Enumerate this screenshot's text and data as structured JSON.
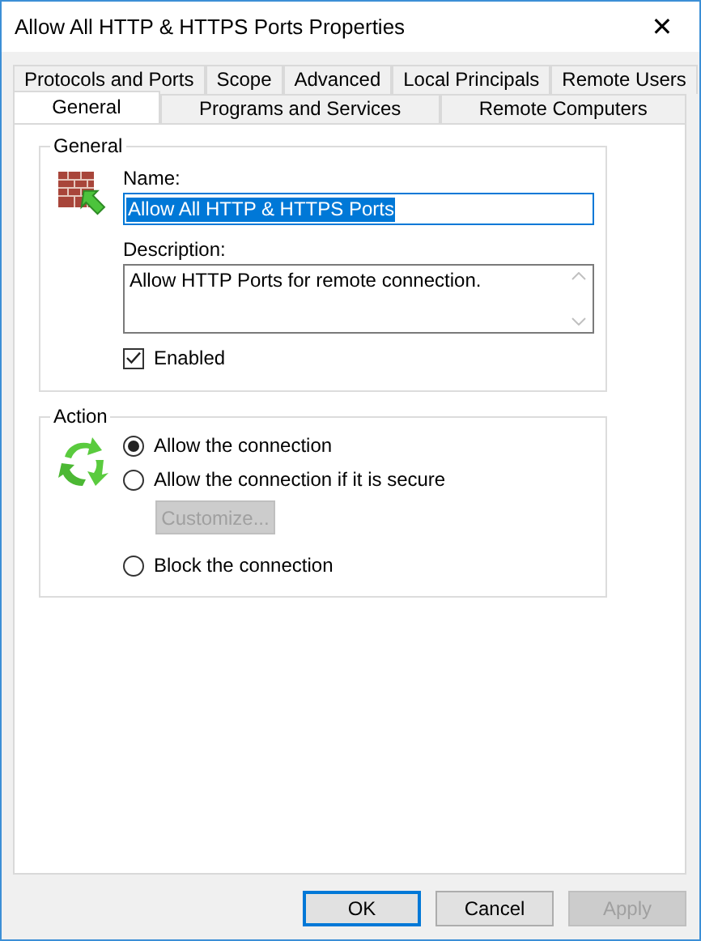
{
  "window": {
    "title": "Allow All HTTP & HTTPS Ports Properties",
    "close": "✕"
  },
  "tab_rows": [
    [
      {
        "label": "Protocols and Ports",
        "selected": false
      },
      {
        "label": "Scope",
        "selected": false
      },
      {
        "label": "Advanced",
        "selected": false
      },
      {
        "label": "Local Principals",
        "selected": false
      },
      {
        "label": "Remote Users",
        "selected": false
      }
    ],
    [
      {
        "label": "General",
        "selected": true
      },
      {
        "label": "Programs and Services",
        "selected": false
      },
      {
        "label": "Remote Computers",
        "selected": false
      }
    ]
  ],
  "general": {
    "title": "General",
    "name_label": "Name:",
    "name_value": "Allow All HTTP & HTTPS Ports",
    "name_text_selected": true,
    "description_label": "Description:",
    "description": "Allow HTTP Ports for remote connection.",
    "enabled": {
      "label": "Enabled",
      "checked": true
    }
  },
  "action": {
    "title": "Action",
    "options": [
      {
        "label": "Allow the connection",
        "selected": true
      },
      {
        "label": "Allow the connection if it is secure",
        "selected": false
      },
      {
        "label": "Block the connection",
        "selected": false
      }
    ],
    "customize": {
      "label": "Customize...",
      "disabled": true
    }
  },
  "buttons": [
    {
      "label": "OK",
      "default": true,
      "disabled": false
    },
    {
      "label": "Cancel",
      "default": false,
      "disabled": false
    },
    {
      "label": "Apply",
      "default": false,
      "disabled": true
    }
  ]
}
